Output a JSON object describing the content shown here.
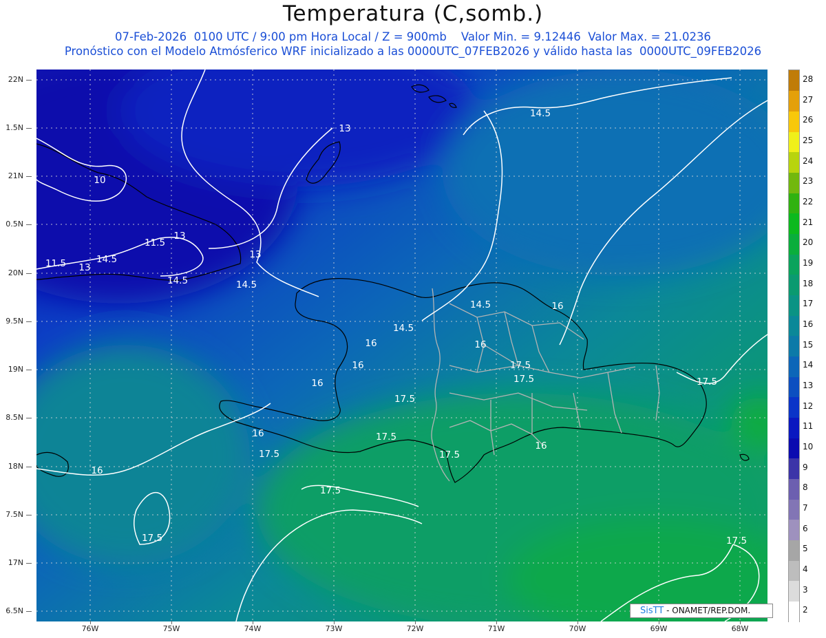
{
  "header": {
    "title": "Temperatura (C,somb.)",
    "line1": "07-Feb-2026  0100 UTC / 9:00 pm Hora Local / Z = 900mb    Valor Min. = 9.12446  Valor Max. = 21.0236",
    "line2": "Pronóstico con el Modelo Atmósferico WRF inicializado a las 0000UTC_07FEB2026 y válido hasta las  0000UTC_09FEB2026"
  },
  "axes": {
    "lat_labels": [
      "22N",
      "1.5N",
      "21N",
      "0.5N",
      "20N",
      "9.5N",
      "19N",
      "8.5N",
      "18N",
      "7.5N",
      "17N",
      "6.5N"
    ],
    "lon_labels": [
      "76W",
      "75W",
      "74W",
      "73W",
      "72W",
      "71W",
      "70W",
      "69W",
      "68W"
    ]
  },
  "colorbar": {
    "labels": [
      "2",
      "3",
      "4",
      "5",
      "6",
      "7",
      "8",
      "9",
      "10",
      "11",
      "12",
      "13",
      "14",
      "15",
      "16",
      "17",
      "18",
      "19",
      "20",
      "21",
      "22",
      "23",
      "24",
      "25",
      "26",
      "27",
      "28"
    ],
    "colors": [
      "#ffffff",
      "#dcdcdc",
      "#bdbdbd",
      "#a6a6a6",
      "#9e91be",
      "#8275b5",
      "#6c5fb0",
      "#3c34a8",
      "#0b0bb0",
      "#0a18c0",
      "#0a34c8",
      "#0c4fc0",
      "#0c66b8",
      "#0c7aa8",
      "#0b8898",
      "#0b9384",
      "#0b9a70",
      "#0aa35c",
      "#0aae3c",
      "#0cb91e",
      "#30b210",
      "#72b80e",
      "#b8d40e",
      "#f0f01a",
      "#f8c80a",
      "#e4a00a",
      "#c07c08"
    ]
  },
  "contour_labels": [
    "14.5",
    "13",
    "10",
    "11.5",
    "13",
    "11.5",
    "13",
    "14.5",
    "13",
    "14.5",
    "14.5",
    "14.5",
    "16",
    "14.5",
    "16",
    "16",
    "16",
    "16",
    "17.5",
    "17.5",
    "17.5",
    "16",
    "17.5",
    "17.5",
    "17.5",
    "16",
    "16",
    "17.5",
    "17.5",
    "17.5",
    "17.5"
  ],
  "credit": {
    "brand": "SisTT",
    "text": " - ONAMET/REP.DOM."
  }
}
